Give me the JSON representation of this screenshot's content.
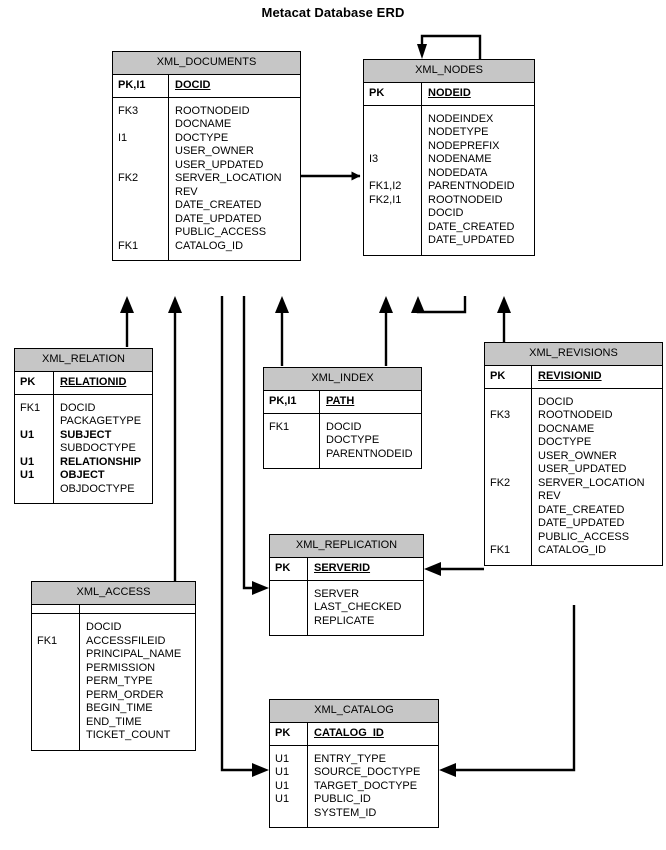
{
  "title": "Metacat Database ERD",
  "colors": {
    "header_fill": "#c6c6c6",
    "box_fill": "#ffffff",
    "line": "#000000",
    "text": "#000000"
  },
  "entities": [
    {
      "name": "XML_DOCUMENTS",
      "pk_key": "PK,I1",
      "pk_field": "DOCID",
      "keys": [
        "FK3",
        "",
        "I1",
        "",
        "",
        "FK2",
        "",
        "",
        "",
        "",
        "FK1"
      ],
      "fields": [
        "ROOTNODEID",
        "DOCNAME",
        "DOCTYPE",
        "USER_OWNER",
        "USER_UPDATED",
        "SERVER_LOCATION",
        "REV",
        "DATE_CREATED",
        "DATE_UPDATED",
        "PUBLIC_ACCESS",
        "CATALOG_ID"
      ],
      "bold": [
        false,
        false,
        false,
        false,
        false,
        false,
        false,
        false,
        false,
        false,
        false
      ]
    },
    {
      "name": "XML_NODES",
      "pk_key": "PK",
      "pk_field": "NODEID",
      "keys": [
        "",
        "",
        "",
        "I3",
        "",
        "FK1,I2",
        "FK2,I1",
        "",
        "",
        ""
      ],
      "fields": [
        "NODEINDEX",
        "NODETYPE",
        "NODEPREFIX",
        "NODENAME",
        "NODEDATA",
        "PARENTNODEID",
        "ROOTNODEID",
        "DOCID",
        "DATE_CREATED",
        "DATE_UPDATED"
      ],
      "bold": [
        false,
        false,
        false,
        false,
        false,
        false,
        false,
        false,
        false,
        false
      ]
    },
    {
      "name": "XML_RELATION",
      "pk_key": "PK",
      "pk_field": "RELATIONID",
      "keys": [
        "FK1",
        "",
        "U1",
        "",
        "U1",
        "U1",
        ""
      ],
      "fields": [
        "DOCID",
        "PACKAGETYPE",
        "SUBJECT",
        "SUBDOCTYPE",
        "RELATIONSHIP",
        "OBJECT",
        "OBJDOCTYPE"
      ],
      "bold": [
        false,
        false,
        true,
        false,
        true,
        true,
        false
      ]
    },
    {
      "name": "XML_INDEX",
      "pk_key": "PK,I1",
      "pk_field": "PATH",
      "keys": [
        "FK1",
        "",
        ""
      ],
      "fields": [
        "DOCID",
        "DOCTYPE",
        "PARENTNODEID"
      ],
      "bold": [
        false,
        false,
        false
      ]
    },
    {
      "name": "XML_REVISIONS",
      "pk_key": "PK",
      "pk_field": "REVISIONID",
      "keys": [
        "",
        "FK3",
        "",
        "",
        "",
        "",
        "FK2",
        "",
        "",
        "",
        "",
        "FK1"
      ],
      "fields": [
        "DOCID",
        "ROOTNODEID",
        "DOCNAME",
        "DOCTYPE",
        "USER_OWNER",
        "USER_UPDATED",
        "SERVER_LOCATION",
        "REV",
        "DATE_CREATED",
        "DATE_UPDATED",
        "PUBLIC_ACCESS",
        "CATALOG_ID"
      ],
      "bold": [
        false,
        false,
        false,
        false,
        false,
        false,
        false,
        false,
        false,
        false,
        false,
        false
      ]
    },
    {
      "name": "XML_REPLICATION",
      "pk_key": "PK",
      "pk_field": "SERVERID",
      "keys": [
        "",
        "",
        ""
      ],
      "fields": [
        "SERVER",
        "LAST_CHECKED",
        "REPLICATE"
      ],
      "bold": [
        false,
        false,
        false
      ]
    },
    {
      "name": "XML_ACCESS",
      "pk_key": "",
      "pk_field": "",
      "keys": [
        "",
        "FK1",
        "",
        "",
        "",
        "",
        "",
        "",
        ""
      ],
      "fields": [
        "DOCID",
        "ACCESSFILEID",
        "PRINCIPAL_NAME",
        "PERMISSION",
        "PERM_TYPE",
        "PERM_ORDER",
        "BEGIN_TIME",
        "END_TIME",
        "TICKET_COUNT"
      ],
      "bold": [
        false,
        false,
        false,
        false,
        false,
        false,
        false,
        false,
        false
      ]
    },
    {
      "name": "XML_CATALOG",
      "pk_key": "PK",
      "pk_field": "CATALOG_ID",
      "keys": [
        "U1",
        "U1",
        "U1",
        "U1",
        ""
      ],
      "fields": [
        "ENTRY_TYPE",
        "SOURCE_DOCTYPE",
        "TARGET_DOCTYPE",
        "PUBLIC_ID",
        "SYSTEM_ID"
      ],
      "bold": [
        false,
        false,
        false,
        false,
        false
      ]
    }
  ],
  "relationships": [
    {
      "from": "XML_DOCUMENTS",
      "to": "XML_NODES",
      "label": ""
    },
    {
      "from": "XML_NODES",
      "to": "XML_NODES",
      "label": ""
    },
    {
      "from": "XML_RELATION",
      "to": "XML_DOCUMENTS",
      "label": ""
    },
    {
      "from": "XML_ACCESS",
      "to": "XML_DOCUMENTS",
      "label": ""
    },
    {
      "from": "XML_INDEX",
      "to": "XML_DOCUMENTS",
      "label": ""
    },
    {
      "from": "XML_REVISIONS",
      "to": "XML_DOCUMENTS",
      "label": ""
    },
    {
      "from": "XML_INDEX",
      "to": "XML_NODES",
      "label": ""
    },
    {
      "from": "XML_REVISIONS",
      "to": "XML_NODES",
      "label": ""
    },
    {
      "from": "XML_REVISIONS",
      "to": "XML_REPLICATION",
      "label": ""
    },
    {
      "from": "XML_REVISIONS",
      "to": "XML_CATALOG",
      "label": ""
    },
    {
      "from": "XML_DOCUMENTS",
      "to": "XML_REPLICATION",
      "label": ""
    },
    {
      "from": "XML_DOCUMENTS",
      "to": "XML_CATALOG",
      "label": ""
    }
  ]
}
